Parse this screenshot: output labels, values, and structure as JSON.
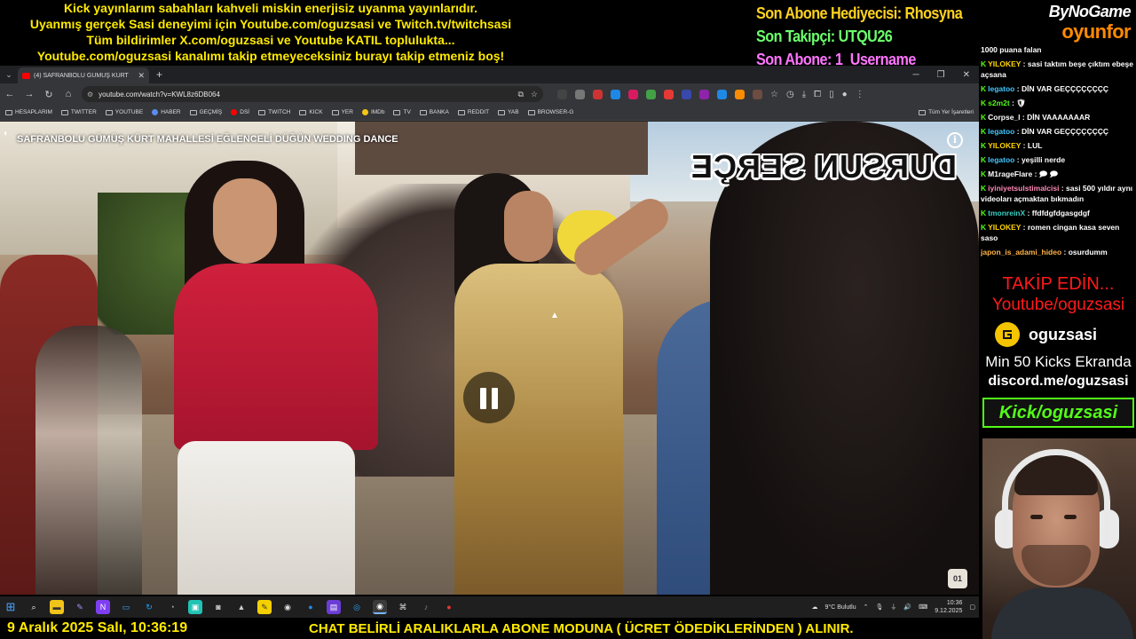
{
  "top_banner": {
    "lines": [
      "Kick yayınlarım sabahları kahveli miskin enerjisiz uyanma yayınlarıdır.",
      "Uyanmış gerçek Sasi deneyimi için Youtube.com/oguzsasi ve Twitch.tv/twitchsasi",
      "Tüm bildirimler X.com/oguzsasi ve Youtube KATIL toplulukta...",
      "Youtube.com/oguzsasi kanalımı takip etmeyeceksiniz burayı takip etmeniz boş!"
    ]
  },
  "stream_stats": {
    "hediye": "Son Abone Hediyecisi: Rhosyna",
    "takipci": "Son Takipçi: UTQU26",
    "abone": "Son Abone: 1_Username"
  },
  "brand": {
    "top": "ByNoGame",
    "bottom": "oyunfor"
  },
  "browser": {
    "tab_title": "(4) SAFRANBOLU GÜMÜŞ KÜRT",
    "url": "youtube.com/watch?v=KWL8z6DB064",
    "bookmarks": [
      "HESAPLARIM",
      "TWITTER",
      "YOUTUBE",
      "HABER",
      "GEÇMİŞ",
      "DSİ",
      "TWITCH",
      "KICK",
      "YER",
      "IMDb",
      "TV",
      "BANKA",
      "REDDIT",
      "YAB",
      "BROWSER-G"
    ],
    "bookmarks_all": "Tüm Yer İşaretleri"
  },
  "video": {
    "title": "SAFRANBOLU GÜMÜŞ KÜRT MAHALLESİ EĞLENCELİ DÜĞÜN WEDDING DANCE",
    "caption": "DURSUN SERÇE",
    "channel_logo": "01"
  },
  "taskbar": {
    "weather": "9°C  Bulutlu",
    "time": "10:36",
    "date": "9.12.2025"
  },
  "bottom_banner": {
    "date": "9 Aralık 2025 Salı, 10:36:19",
    "message": "CHAT BELİRLİ ARALIKLARLA ABONE MODUNA ( ÜCRET ÖDEDİKLERİNDEN ) ALINIR."
  },
  "chat": {
    "messages": [
      {
        "user": "",
        "text": "1000 puana falan"
      },
      {
        "user": "YILOKEY",
        "text": "sasi taktım beşe çıktım ebeşe açsana"
      },
      {
        "user": "legatoo",
        "text": "DİN VAR GEÇÇÇÇÇÇÇÇ"
      },
      {
        "user": "s2m2t",
        "text": "🛡"
      },
      {
        "user": "Corpse_l",
        "text": "DİN VAAAAAAAR"
      },
      {
        "user": "legatoo",
        "text": "DİN VAR GEÇÇÇÇÇÇÇÇ"
      },
      {
        "user": "YILOKEY",
        "text": "LUL"
      },
      {
        "user": "legatoo",
        "text": "yeşilli nerde"
      },
      {
        "user": "M1rageFlare",
        "text": "🗩 🗩"
      },
      {
        "user": "iyiniyetsulstimalcisi",
        "text": "sasi 500 yıldır aynı videoları açmaktan bıkmadın"
      },
      {
        "user": "tmonreinX",
        "text": "ffdfdgfdgasgdgf"
      },
      {
        "user": "YILOKEY",
        "text": "romen cingan kasa seven saso"
      },
      {
        "user": "japon_is_adami_hideo",
        "text": "osurdumm"
      }
    ]
  },
  "follow": {
    "takip_edin": "TAKİP EDİN...",
    "youtube": "Youtube/oguzsasi",
    "guilded_name": "oguzsasi",
    "kicks": "Min 50 Kicks Ekranda",
    "discord": "discord.me/oguzsasi",
    "kick": "Kick/oguzsasi"
  },
  "colors": {
    "banner_yellow": "#ffea00",
    "kick_green": "#53fc18",
    "follow_red": "#ff1a1a",
    "youtube_red": "#ff0000"
  }
}
